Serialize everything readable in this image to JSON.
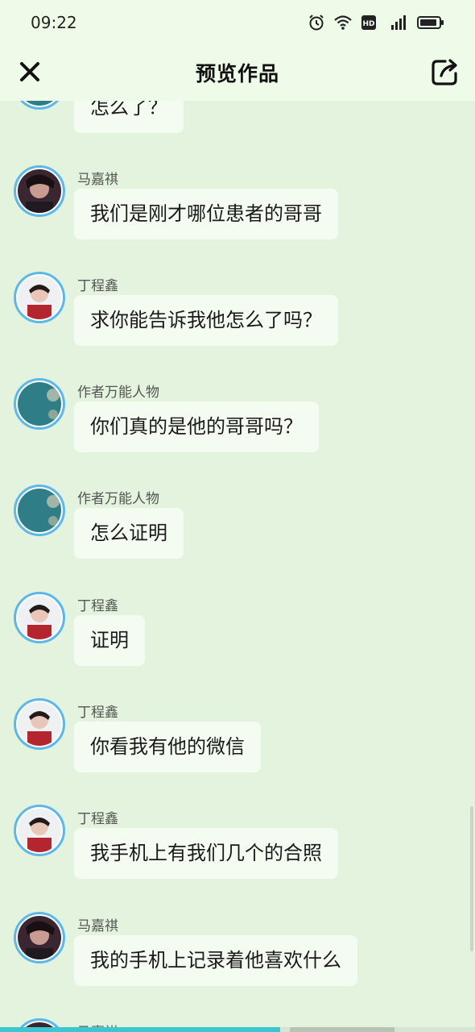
{
  "status_bar": {
    "time": "09:22",
    "network": "4G"
  },
  "nav": {
    "title": "预览作品"
  },
  "messages": [
    {
      "name": "",
      "text": "怎么了？",
      "avatar": "teal"
    },
    {
      "name": "马嘉祺",
      "text": "我们是刚才哪位患者的哥哥",
      "avatar": "dark"
    },
    {
      "name": "丁程鑫",
      "text": "求你能告诉我他怎么了吗？",
      "avatar": "red"
    },
    {
      "name": "作者万能人物",
      "text": "你们真的是他的哥哥吗？",
      "avatar": "teal"
    },
    {
      "name": "作者万能人物",
      "text": "怎么证明",
      "avatar": "teal"
    },
    {
      "name": "丁程鑫",
      "text": "证明",
      "avatar": "red"
    },
    {
      "name": "丁程鑫",
      "text": "你看我有他的微信",
      "avatar": "red"
    },
    {
      "name": "丁程鑫",
      "text": "我手机上有我们几个的合照",
      "avatar": "red"
    },
    {
      "name": "马嘉祺",
      "text": "我的手机上记录着他喜欢什么",
      "avatar": "dark"
    },
    {
      "name": "马嘉祺",
      "text": "",
      "avatar": "dark"
    }
  ],
  "progress": {
    "value": 0.59
  },
  "colors": {
    "background": "#e3f3dd",
    "bar": "#eefbe9",
    "bubble": "#f4fcf2",
    "avatar_ring": "#5cb8ea",
    "progress": "#3cc6d2"
  },
  "icons": {
    "close": "close-icon",
    "share": "share-icon",
    "alarm": "alarm-icon",
    "wifi": "wifi-icon",
    "hd": "hd-icon",
    "signal": "signal-icon",
    "battery": "battery-icon"
  }
}
